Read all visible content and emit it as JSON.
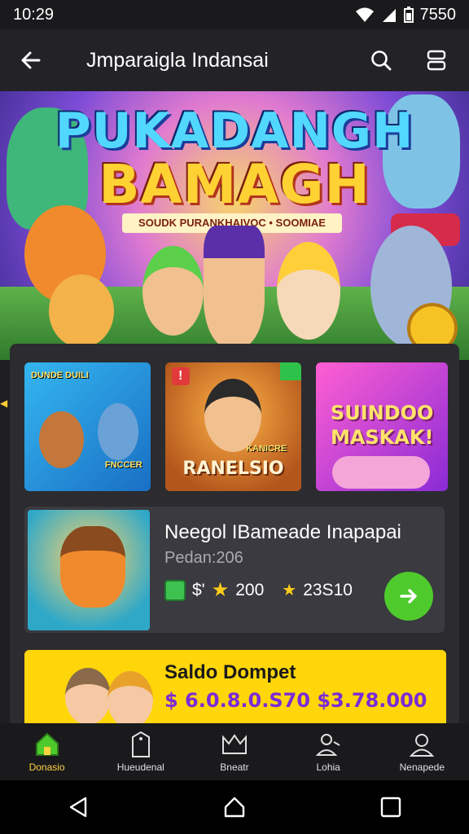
{
  "status_bar": {
    "time": "10:29",
    "battery": "7550"
  },
  "app_bar": {
    "title": "Jmparaigla Indansai"
  },
  "hero": {
    "title_line1": "PUKADANGH",
    "title_line2": "BAMAGH",
    "subtitle": "SOUDK PURANKHAIVOC • SOOMIAE"
  },
  "thumbnails": [
    {
      "label_top": "DUNDE DUILI",
      "label_bottom": "FNCCER"
    },
    {
      "badge": "!",
      "label": "RANELSIO",
      "label_small": "KANICRE"
    },
    {
      "label_line1": "SUINDOO",
      "label_line2": "MASKAK!"
    }
  ],
  "featured_card": {
    "name": "Neegol IBameade Inapapai",
    "subtitle": "Pedan:206",
    "stat1_prefix": "$'",
    "stat2_value": "200",
    "stat3_value": "23S10"
  },
  "wallet": {
    "label": "Saldo Dompet",
    "amount": "$ 6.0.8.0.S70 $3.78.000"
  },
  "bottom_nav": [
    {
      "label": "Donasio"
    },
    {
      "label": "Hueudenal"
    },
    {
      "label": "Bneatr"
    },
    {
      "label": "Lohia"
    },
    {
      "label": "Nenapede"
    }
  ],
  "colors": {
    "accent_yellow": "#ffd60a",
    "accent_green": "#4fca2d",
    "nav_active": "#ffd23f"
  }
}
